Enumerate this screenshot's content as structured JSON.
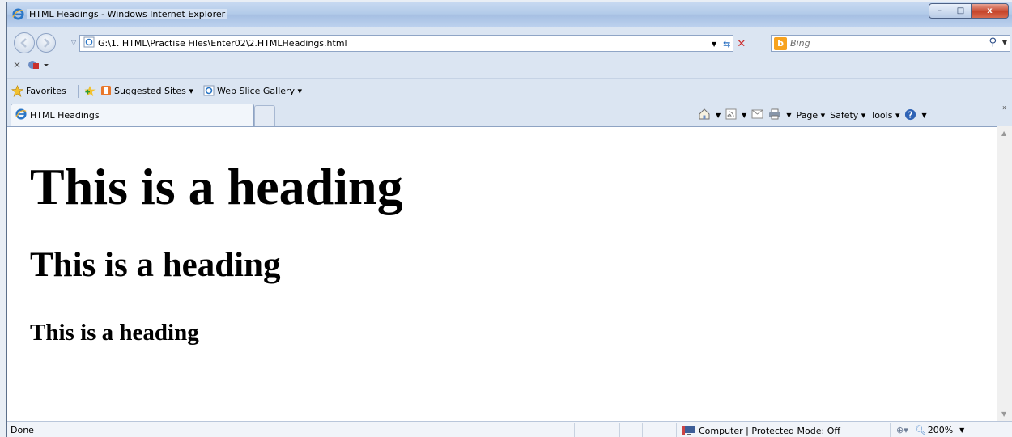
{
  "window": {
    "title": "HTML Headings - Windows Internet Explorer",
    "minimize_glyph": "–",
    "maximize_glyph": "□",
    "close_glyph": "x"
  },
  "nav": {
    "address": "G:\\1. HTML\\Practise Files\\Enter02\\2.HTMLHeadings.html",
    "search_placeholder": "Bing",
    "search_provider_glyph": "b"
  },
  "command_row": {
    "close_glyph": "×"
  },
  "favorites": {
    "favorites_label": "Favorites",
    "suggested_sites_label": "Suggested Sites ▾",
    "web_slice_label": "Web Slice Gallery ▾"
  },
  "tabs": [
    {
      "label": "HTML Headings",
      "active": true
    }
  ],
  "command_bar": {
    "page_label": "Page ▾",
    "safety_label": "Safety ▾",
    "tools_label": "Tools ▾",
    "more_glyph": "»"
  },
  "content": {
    "headings": [
      {
        "level": 1,
        "text": "This is a heading"
      },
      {
        "level": 2,
        "text": "This is a heading"
      },
      {
        "level": 3,
        "text": "This is a heading"
      }
    ]
  },
  "status": {
    "text": "Done",
    "zone": "Computer | Protected Mode: Off",
    "zoom": "200%"
  },
  "icons": [
    "ie-logo-icon",
    "back-icon",
    "forward-icon",
    "refresh-icon",
    "stop-icon",
    "search-icon",
    "star-icon",
    "home-icon",
    "feeds-icon",
    "mail-icon",
    "print-icon",
    "help-icon",
    "globe-icon",
    "zoom-icon"
  ],
  "colors": {
    "titlebar": "#b3cbe9",
    "close": "#c6452b",
    "bing": "#f7a21e",
    "accent_blue": "#2a4b86"
  }
}
